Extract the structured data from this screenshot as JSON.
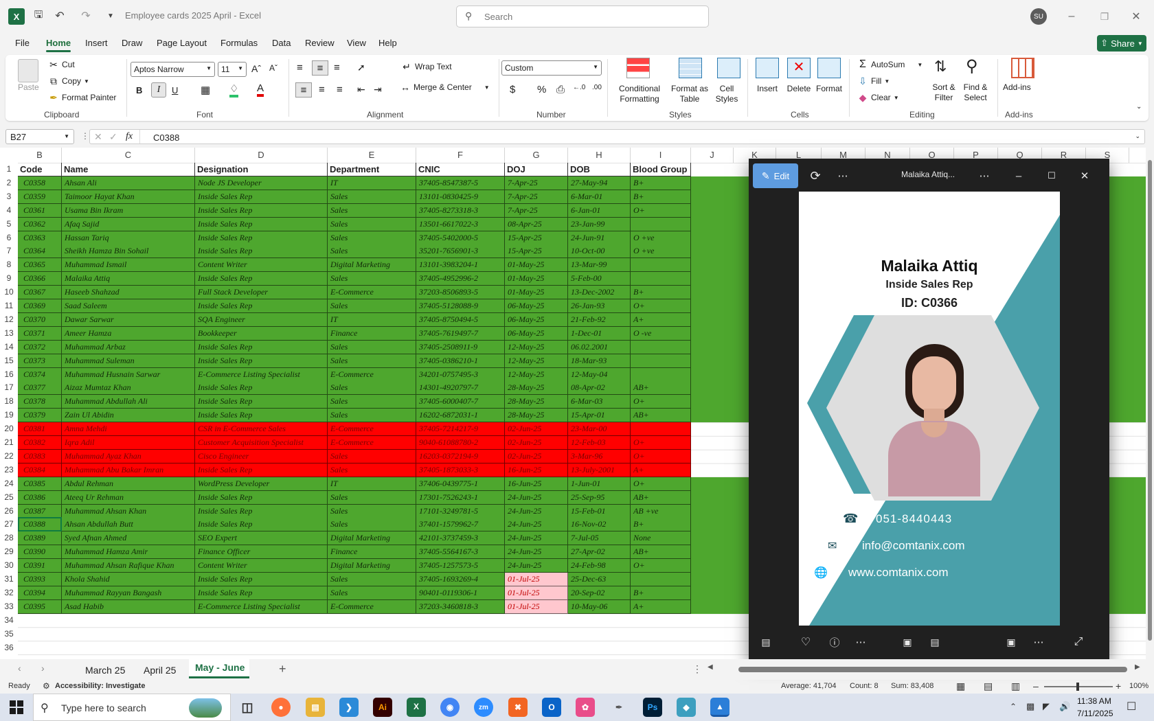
{
  "window": {
    "title": "Employee cards 2025 April  -  Excel",
    "search_placeholder": "Search",
    "user_initials": "SU"
  },
  "menu": [
    "File",
    "Home",
    "Insert",
    "Draw",
    "Page Layout",
    "Formulas",
    "Data",
    "Review",
    "View",
    "Help"
  ],
  "share_label": "Share",
  "ribbon": {
    "clipboard": {
      "paste": "Paste",
      "cut": "Cut",
      "copy": "Copy",
      "format_painter": "Format Painter",
      "group": "Clipboard"
    },
    "font": {
      "name": "Aptos Narrow",
      "size": "11",
      "group": "Font"
    },
    "alignment": {
      "wrap": "Wrap Text",
      "merge": "Merge & Center",
      "group": "Alignment"
    },
    "number": {
      "format": "Custom",
      "group": "Number"
    },
    "styles": {
      "conditional": "Conditional Formatting",
      "format_table": "Format as Table",
      "cell_styles": "Cell Styles",
      "group": "Styles"
    },
    "cells": {
      "insert": "Insert",
      "delete": "Delete",
      "format": "Format",
      "group": "Cells"
    },
    "editing": {
      "autosum": "AutoSum",
      "fill": "Fill",
      "clear": "Clear",
      "sort": "Sort & Filter",
      "find": "Find & Select",
      "group": "Editing"
    },
    "addins": {
      "label": "Add-ins",
      "group": "Add-ins"
    }
  },
  "formula_bar": {
    "name_box": "B27",
    "formula": "C0388"
  },
  "columns": [
    "B",
    "C",
    "D",
    "E",
    "F",
    "G",
    "H",
    "I",
    "J",
    "K",
    "L",
    "M",
    "N",
    "O",
    "P",
    "Q",
    "R",
    "S"
  ],
  "row_numbers": [
    "1",
    "2",
    "3",
    "4",
    "5",
    "6",
    "7",
    "8",
    "9",
    "10",
    "11",
    "12",
    "13",
    "14",
    "15",
    "16",
    "17",
    "18",
    "19",
    "20",
    "21",
    "22",
    "23",
    "24",
    "25",
    "26",
    "27",
    "28",
    "29",
    "30",
    "31",
    "32",
    "33",
    "34",
    "35",
    "36"
  ],
  "headers": [
    "Code",
    "Name",
    "Designation",
    "Department",
    "CNIC",
    "DOJ",
    "DOB",
    "Blood Group"
  ],
  "rows": [
    {
      "status": "green",
      "cells": [
        "C0358",
        "Ahsan Ali",
        "Node JS Developer",
        "IT",
        "37405-8547387-5",
        "7-Apr-25",
        "27-May-94",
        "B+"
      ]
    },
    {
      "status": "green",
      "cells": [
        "C0359",
        "Taimoor Hayat Khan",
        "Inside Sales Rep",
        "Sales",
        "13101-0830425-9",
        "7-Apr-25",
        "6-Mar-01",
        "B+"
      ]
    },
    {
      "status": "green",
      "cells": [
        "C0361",
        "Usama Bin Ikram",
        "Inside Sales Rep",
        "Sales",
        "37405-8273318-3",
        "7-Apr-25",
        "6-Jan-01",
        "O+"
      ]
    },
    {
      "status": "green",
      "cells": [
        "C0362",
        "Afaq Sajid",
        "Inside Sales Rep",
        "Sales",
        "13501-6617022-3",
        "08-Apr-25",
        "23-Jan-99",
        ""
      ]
    },
    {
      "status": "green",
      "cells": [
        "C0363",
        "Hassan Tariq",
        "Inside Sales Rep",
        "Sales",
        "37405-5402000-5",
        "15-Apr-25",
        "24-Jun-91",
        "O +ve"
      ]
    },
    {
      "status": "green",
      "cells": [
        "C0364",
        "Sheikh Hamza Bin Sohail",
        "Inside Sales Rep",
        "Sales",
        "35201-7656901-3",
        "15-Apr-25",
        "10-Oct-00",
        "O +ve"
      ]
    },
    {
      "status": "green",
      "cells": [
        "C0365",
        "Muhammad Ismail",
        "Content Writer",
        "Digital Marketing",
        "13101-3983204-1",
        "01-May-25",
        "13-Mar-99",
        ""
      ]
    },
    {
      "status": "green",
      "cells": [
        "C0366",
        "Malaika Attiq",
        "Inside Sales Rep",
        "Sales",
        "37405-4952996-2",
        "01-May-25",
        "5-Feb-00",
        ""
      ]
    },
    {
      "status": "green",
      "cells": [
        "C0367",
        "Haseeb Shahzad",
        "Full Stack Developer",
        "E-Commerce",
        "37203-8506893-5",
        "01-May-25",
        "13-Dec-2002",
        "B+"
      ]
    },
    {
      "status": "green",
      "cells": [
        "C0369",
        "Saad Saleem",
        "Inside Sales Rep",
        "Sales",
        "37405-5128088-9",
        "06-May-25",
        "26-Jan-93",
        "O+"
      ]
    },
    {
      "status": "green",
      "cells": [
        "C0370",
        "Dawar Sarwar",
        "SQA Engineer",
        "IT",
        "37405-8750494-5",
        "06-May-25",
        "21-Feb-92",
        "A+"
      ]
    },
    {
      "status": "green",
      "cells": [
        "C0371",
        "Ameer Hamza",
        "Bookkeeper",
        "Finance",
        "37405-7619497-7",
        "06-May-25",
        "1-Dec-01",
        "O -ve"
      ]
    },
    {
      "status": "green",
      "cells": [
        "C0372",
        "Muhammad Arbaz",
        "Inside Sales Rep",
        "Sales",
        "37405-2508911-9",
        "12-May-25",
        "06.02.2001",
        ""
      ]
    },
    {
      "status": "green",
      "cells": [
        "C0373",
        "Muhammad Suleman",
        "Inside Sales Rep",
        "Sales",
        "37405-0386210-1",
        "12-May-25",
        "18-Mar-93",
        ""
      ]
    },
    {
      "status": "green",
      "cells": [
        "C0374",
        "Muhammad Husnain Sarwar",
        "E-Commerce Listing Specialist",
        "E-Commerce",
        "34201-0757495-3",
        "12-May-25",
        "12-May-04",
        ""
      ]
    },
    {
      "status": "green",
      "cells": [
        "C0377",
        "Aizaz Mumtaz Khan",
        "Inside Sales Rep",
        "Sales",
        "14301-4920797-7",
        "28-May-25",
        "08-Apr-02",
        "AB+"
      ]
    },
    {
      "status": "green",
      "cells": [
        "C0378",
        "Muhammad Abdullah Ali",
        "Inside Sales Rep",
        "Sales",
        "37405-6000407-7",
        "28-May-25",
        "6-Mar-03",
        "O+"
      ]
    },
    {
      "status": "green",
      "cells": [
        "C0379",
        "Zain Ul Abidin",
        "Inside Sales Rep",
        "Sales",
        "16202-6872031-1",
        "28-May-25",
        "15-Apr-01",
        "AB+"
      ]
    },
    {
      "status": "red",
      "cells": [
        "C0381",
        "Amna Mehdi",
        "CSR in E-Commerce Sales",
        "E-Commerce",
        "37405-7214217-9",
        "02-Jun-25",
        "23-Mar-00",
        ""
      ]
    },
    {
      "status": "red",
      "cells": [
        "C0382",
        "Iqra Adil",
        "Customer Acquisition Specialist",
        "E-Commerce",
        "9040-61088780-2",
        "02-Jun-25",
        "12-Feb-03",
        "O+"
      ]
    },
    {
      "status": "red",
      "cells": [
        "C0383",
        "Muhammad Ayaz Khan",
        "Cisco Engineer",
        "Sales",
        "16203-0372194-9",
        "02-Jun-25",
        "3-Mar-96",
        "O+"
      ]
    },
    {
      "status": "red",
      "cells": [
        "C0384",
        "Muhammad Abu Bakar Imran",
        "Inside Sales Rep",
        "Sales",
        "37405-1873033-3",
        "16-Jun-25",
        "13-July-2001",
        "A+"
      ]
    },
    {
      "status": "green",
      "cells": [
        "C0385",
        "Abdul Rehman",
        "WordPress Developer",
        "IT",
        "37406-0439775-1",
        "16-Jun-25",
        "1-Jun-01",
        "O+"
      ]
    },
    {
      "status": "green",
      "cells": [
        "C0386",
        "Ateeq Ur Rehman",
        "Inside Sales Rep",
        "Sales",
        "17301-7526243-1",
        "24-Jun-25",
        "25-Sep-95",
        "AB+"
      ]
    },
    {
      "status": "green",
      "cells": [
        "C0387",
        "Muhammad Ahsan Khan",
        "Inside Sales Rep",
        "Sales",
        "17101-3249781-5",
        "24-Jun-25",
        "15-Feb-01",
        "AB +ve"
      ]
    },
    {
      "status": "green",
      "cells": [
        "C0388",
        "Ahsan Abdullah Butt",
        "Inside Sales Rep",
        "Sales",
        "37401-1579962-7",
        "24-Jun-25",
        "16-Nov-02",
        "B+"
      ]
    },
    {
      "status": "green",
      "cells": [
        "C0389",
        "Syed Afnan Ahmed",
        "SEO Expert",
        "Digital Marketing",
        "42101-3737459-3",
        "24-Jun-25",
        "7-Jul-05",
        "None"
      ]
    },
    {
      "status": "green",
      "cells": [
        "C0390",
        "Muhammad Hamza Amir",
        "Finance Officer",
        "Finance",
        "37405-5564167-3",
        "24-Jun-25",
        "27-Apr-02",
        "AB+"
      ]
    },
    {
      "status": "green",
      "cells": [
        "C0391",
        "Muhammad Ahsan Rafique Khan",
        "Content Writer",
        "Digital Marketing",
        "37405-1257573-5",
        "24-Jun-25",
        "24-Feb-98",
        "O+"
      ]
    },
    {
      "status": "green_pinkdoj",
      "cells": [
        "C0393",
        "Khola Shahid",
        "Inside Sales Rep",
        "Sales",
        "37405-1693269-4",
        "01-Jul-25",
        "25-Dec-63",
        ""
      ]
    },
    {
      "status": "green_pinkdoj",
      "cells": [
        "C0394",
        "Muhammad Rayyan Bangash",
        "Inside Sales Rep",
        "Sales",
        "90401-0119306-1",
        "01-Jul-25",
        "20-Sep-02",
        "B+"
      ]
    },
    {
      "status": "green_pinkdoj",
      "cells": [
        "C0395",
        "Asad Habib",
        "E-Commerce Listing Specialist",
        "E-Commerce",
        "37203-3460818-3",
        "01-Jul-25",
        "10-May-06",
        "A+"
      ]
    }
  ],
  "sheet_tabs": [
    "March 25",
    "April 25",
    "May - June"
  ],
  "active_tab": "May - June",
  "status": {
    "ready": "Ready",
    "accessibility": "Accessibility: Investigate",
    "average": "Average:  41,704",
    "count": "Count: 8",
    "sum": "Sum:  83,408",
    "zoom": "100%"
  },
  "taskbar": {
    "search_placeholder": "Type here to search",
    "time": "11:38 AM",
    "date": "7/11/2025"
  },
  "photo_viewer": {
    "edit_label": "Edit",
    "title": "Malaika Attiq...",
    "card": {
      "name": "Malaika Attiq",
      "role": "Inside Sales Rep",
      "id_label": "ID:  C0366",
      "phone": "051-8440443",
      "email": "info@comtanix.com",
      "web": "www.comtanix.com"
    }
  },
  "colors": {
    "green": "#4ea72e",
    "red": "#ff0000",
    "pink": "#ffc7ce",
    "excel_green": "#1e7145",
    "teal": "#4aa0aa"
  }
}
